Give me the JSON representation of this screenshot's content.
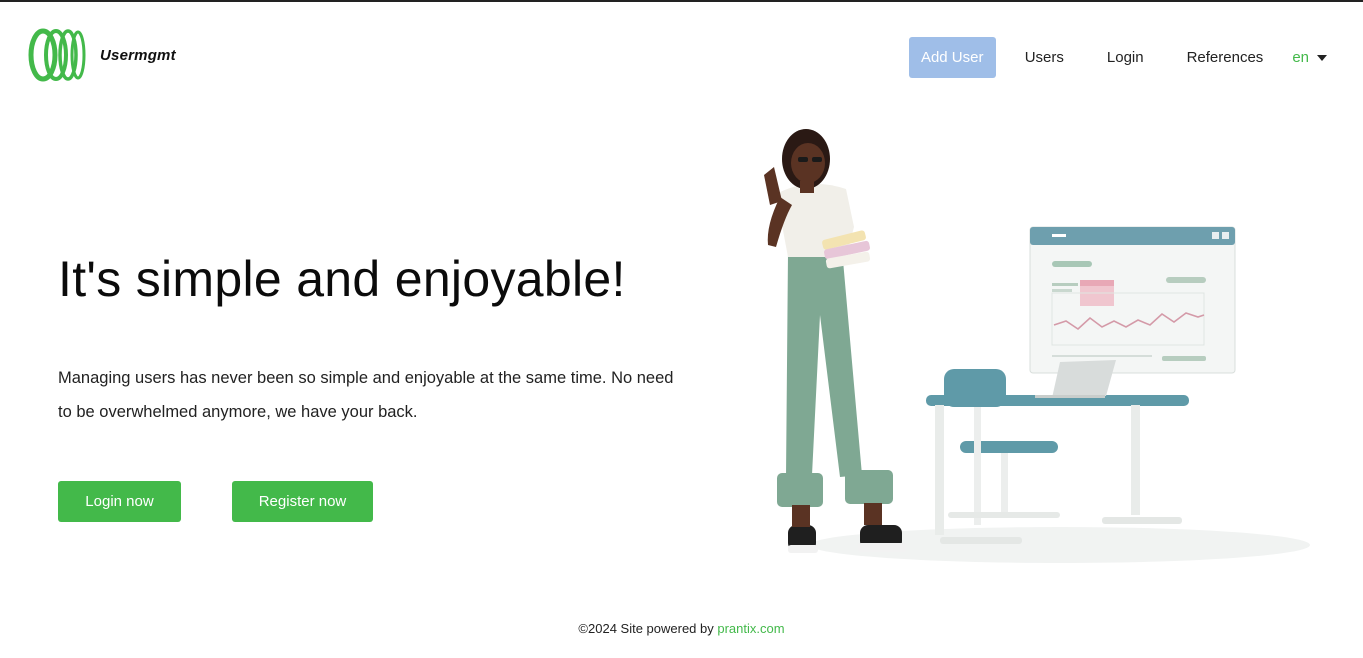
{
  "app": {
    "brand_name": "Usermgmt",
    "logo_icon": "green-rings-logo-icon"
  },
  "nav": {
    "add_user": "Add User",
    "users": "Users",
    "login": "Login",
    "references": "References",
    "language": "en"
  },
  "hero": {
    "title": "It's simple and enjoyable!",
    "description": "Managing users has never been so simple and enjoyable at the same time. No need to be overwhelmed anymore, we have your back.",
    "login_button": "Login now",
    "register_button": "Register now"
  },
  "footer": {
    "prefix": "©2024 Site powered by ",
    "link_text": "prantix.com"
  },
  "colors": {
    "accent_green": "#43b94a",
    "add_user_bg": "#9fbee8",
    "desk_teal": "#5f9aa8",
    "pants_green": "#7fa893"
  }
}
